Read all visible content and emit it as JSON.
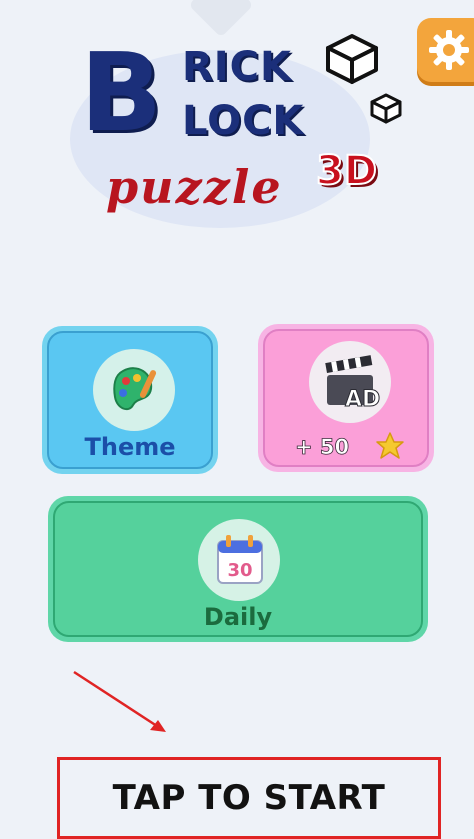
{
  "logo": {
    "big_b": "B",
    "line1": "RICK",
    "line2": "LOCK",
    "tag_3d": "3D",
    "script": "puzzle"
  },
  "settings": {
    "icon": "gear-icon"
  },
  "menu": {
    "theme": {
      "label": "Theme",
      "icon": "palette-icon"
    },
    "ad": {
      "badge": "AD",
      "reward": "+ 50",
      "icon": "clapperboard-icon",
      "reward_icon": "star-icon"
    },
    "daily": {
      "label": "Daily",
      "calendar_day": "30",
      "icon": "calendar-icon"
    }
  },
  "start": {
    "label": "TAP TO START"
  },
  "colors": {
    "background": "#eef2f8",
    "theme_card": "#5ac7f2",
    "ad_card": "#fb9fd8",
    "daily_card": "#55d19c",
    "highlight": "#e02424",
    "settings": "#f3a53c"
  }
}
